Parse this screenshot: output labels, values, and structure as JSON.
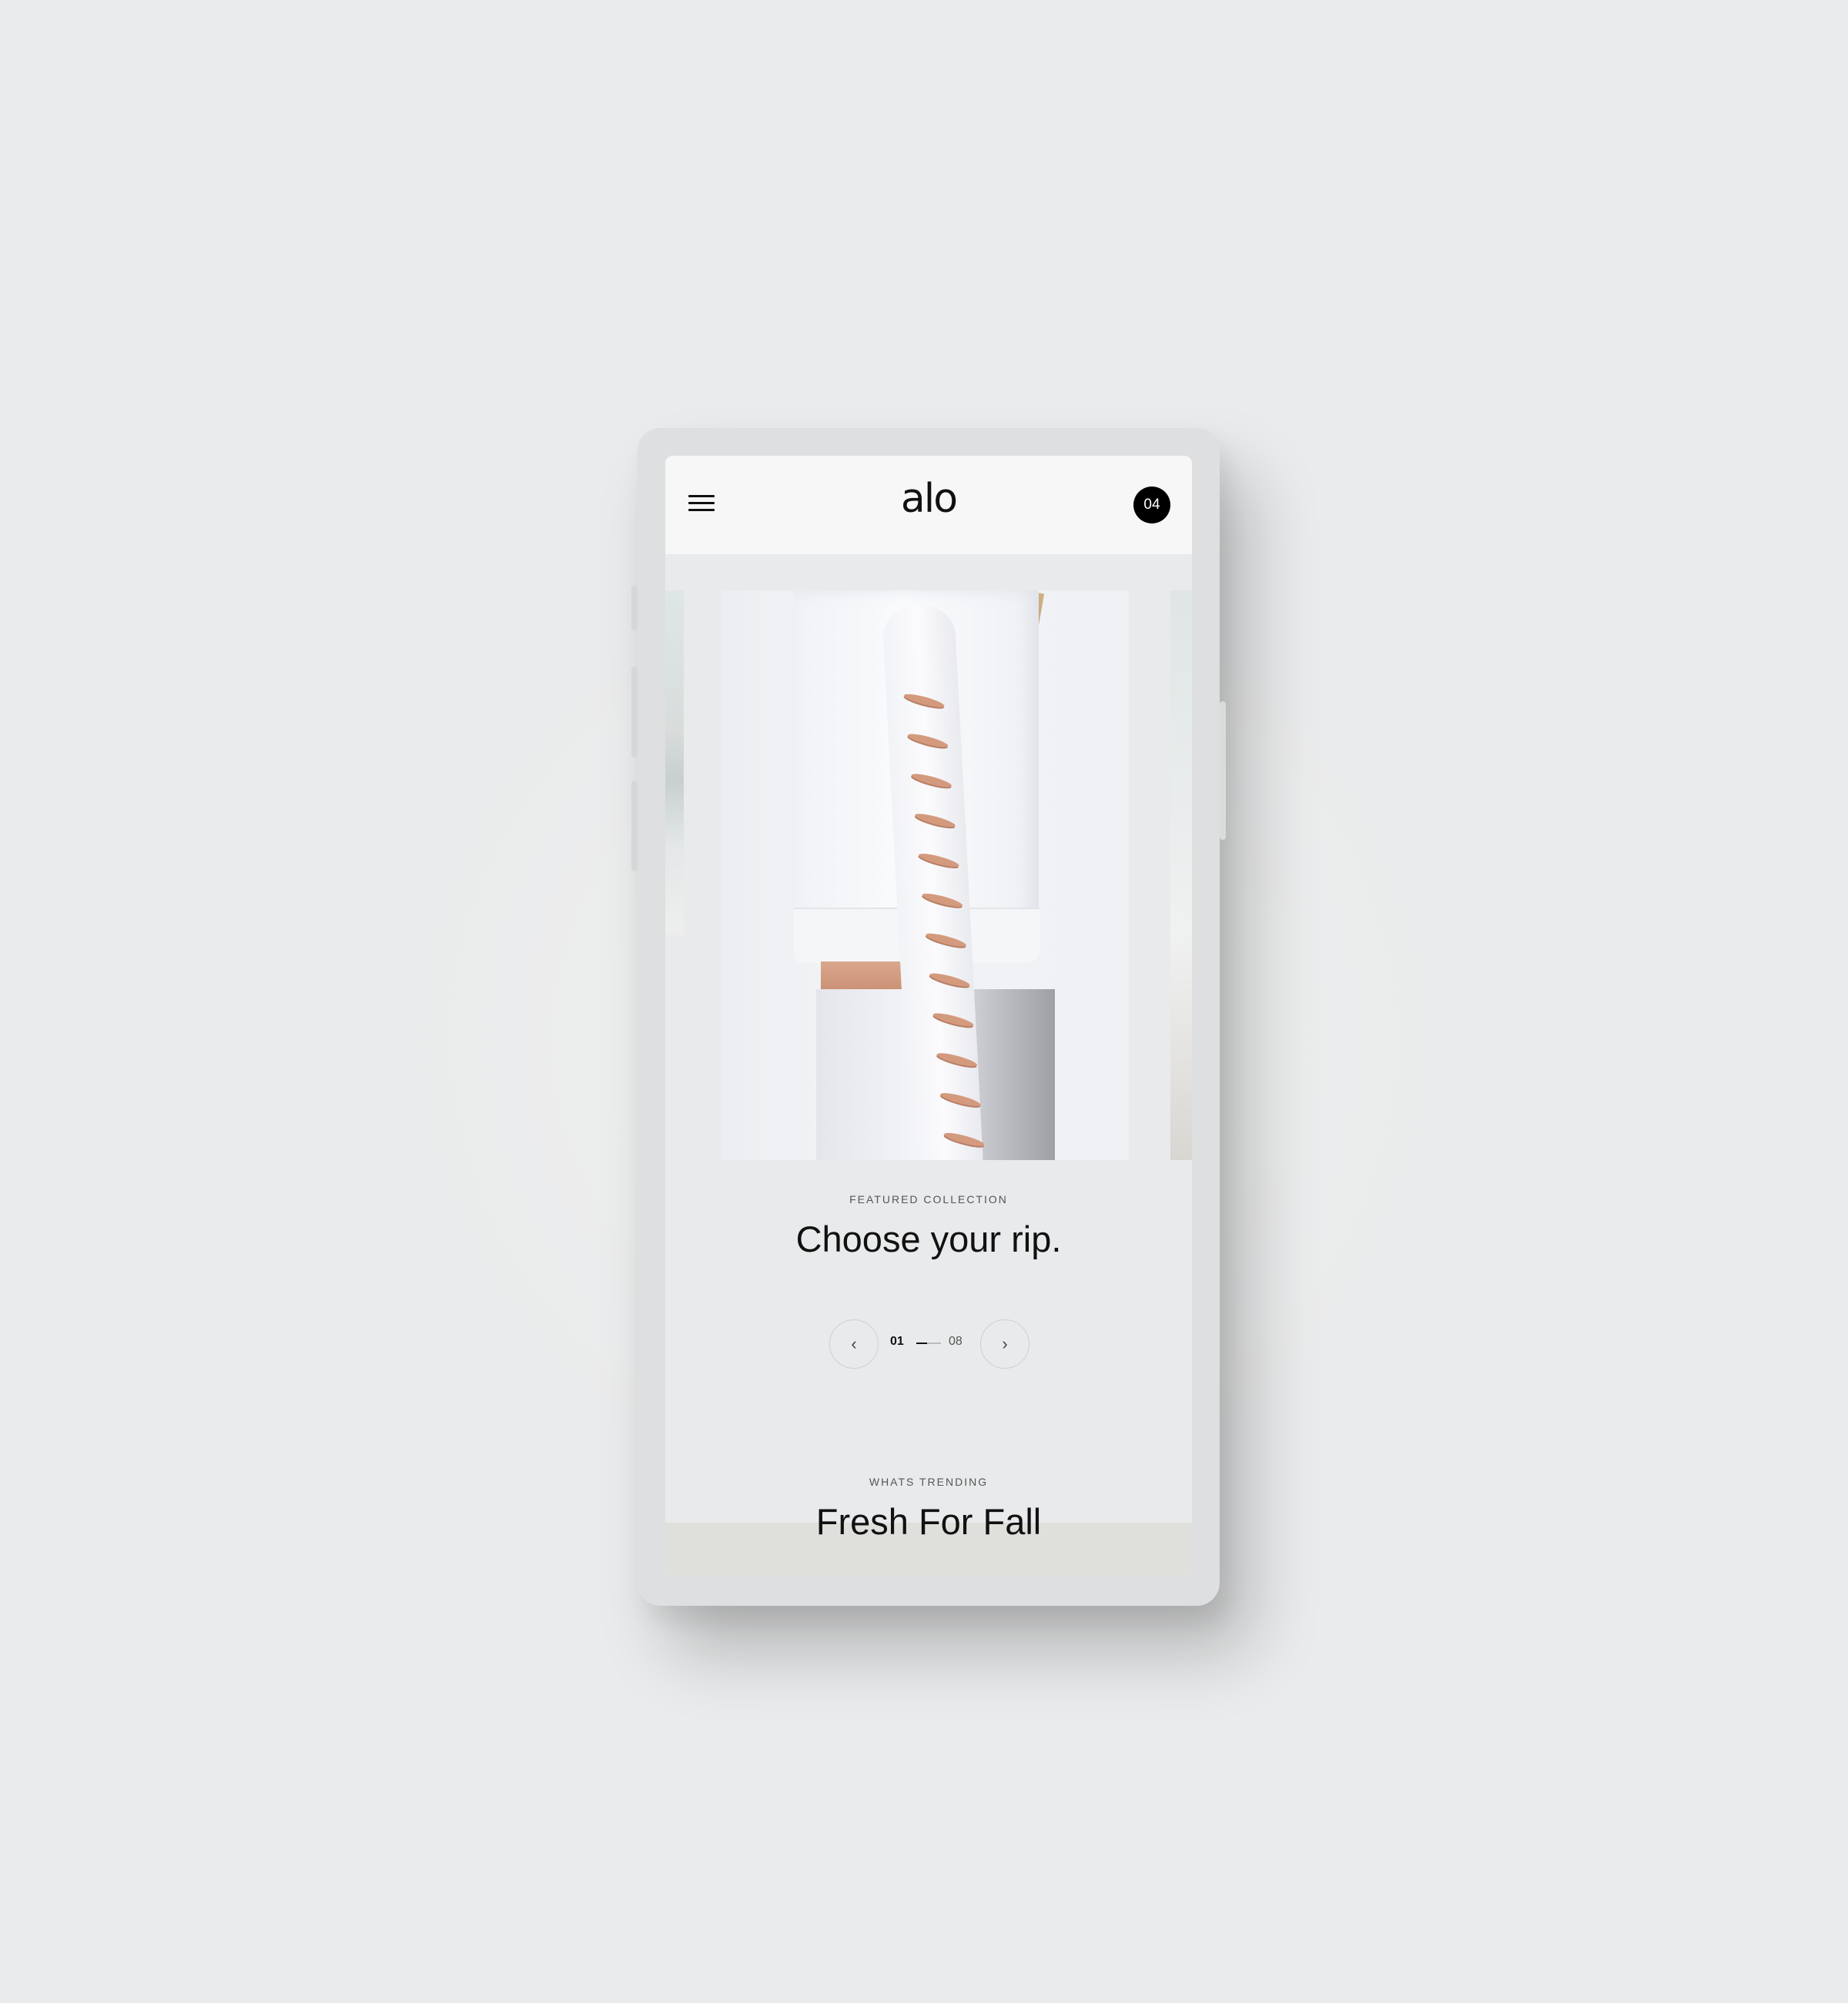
{
  "header": {
    "logo": "alo",
    "cart_count": "04"
  },
  "featured": {
    "eyebrow": "FEATURED COLLECTION",
    "title": "Choose your rip."
  },
  "pager": {
    "current": "01",
    "total": "08",
    "prev_icon": "‹",
    "next_icon": "›"
  },
  "trending": {
    "eyebrow": "WHATS TRENDING",
    "title": "Fresh For Fall"
  }
}
